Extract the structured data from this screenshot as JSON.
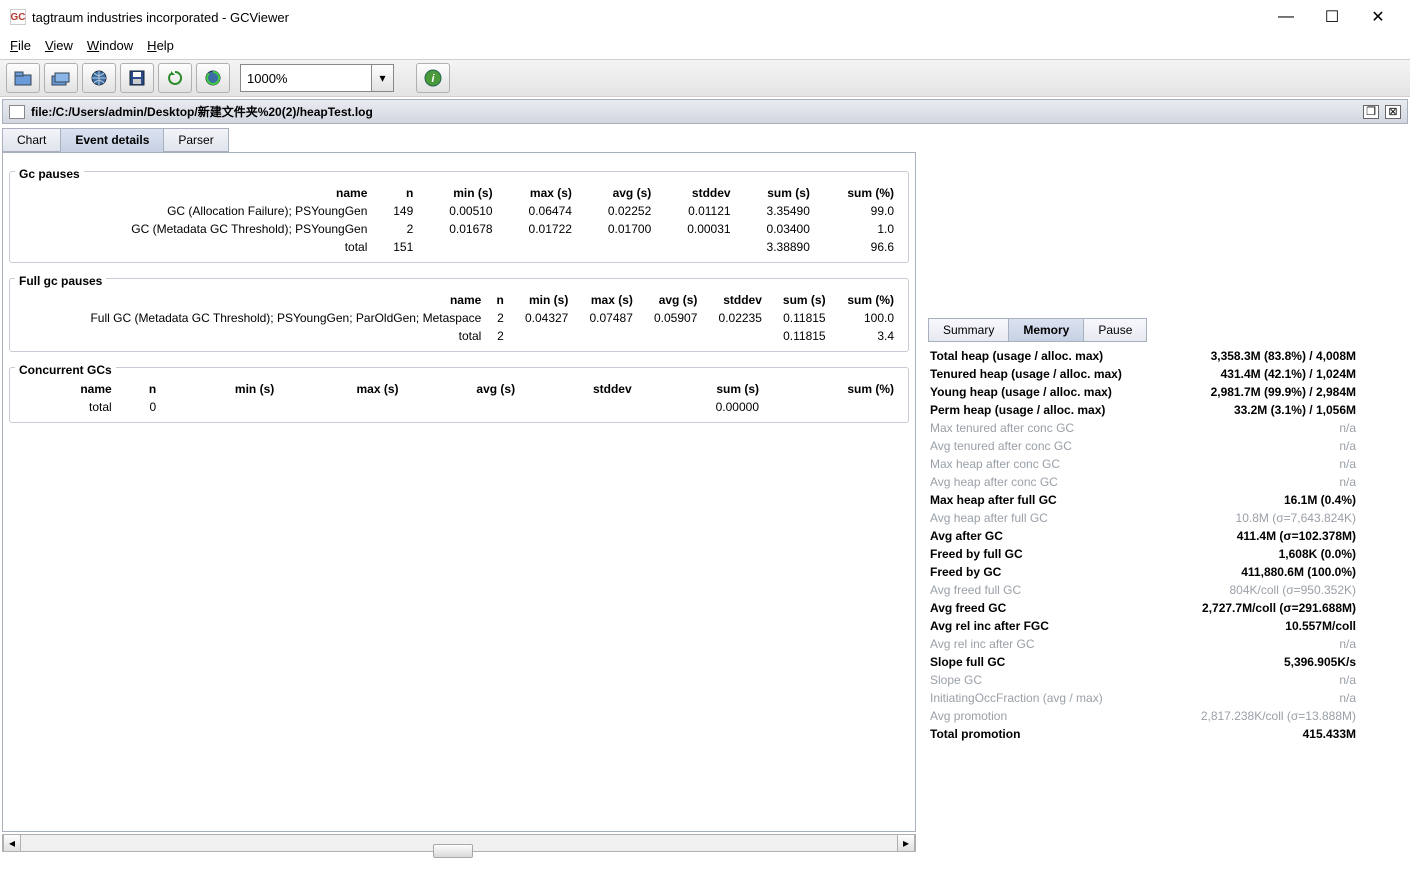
{
  "title": "tagtraum industries incorporated - GCViewer",
  "menu": [
    "File",
    "View",
    "Window",
    "Help"
  ],
  "zoom": "1000%",
  "doc_title": "file:/C:/Users/admin/Desktop/新建文件夹%20(2)/heapTest.log",
  "tabs": [
    "Chart",
    "Event details",
    "Parser"
  ],
  "active_tab": "Event details",
  "sections": {
    "gc_pauses": {
      "title": "Gc pauses",
      "headers": [
        "name",
        "n",
        "min (s)",
        "max (s)",
        "avg (s)",
        "stddev",
        "sum (s)",
        "sum (%)"
      ],
      "rows": [
        [
          "GC (Allocation Failure); PSYoungGen",
          "149",
          "0.00510",
          "0.06474",
          "0.02252",
          "0.01121",
          "3.35490",
          "99.0"
        ],
        [
          "GC (Metadata GC Threshold); PSYoungGen",
          "2",
          "0.01678",
          "0.01722",
          "0.01700",
          "0.00031",
          "0.03400",
          "1.0"
        ],
        [
          "total",
          "151",
          "",
          "",
          "",
          "",
          "3.38890",
          "96.6"
        ]
      ]
    },
    "full_gc_pauses": {
      "title": "Full gc pauses",
      "headers": [
        "name",
        "n",
        "min (s)",
        "max (s)",
        "avg (s)",
        "stddev",
        "sum (s)",
        "sum (%)"
      ],
      "rows": [
        [
          "Full GC (Metadata GC Threshold); PSYoungGen; ParOldGen; Metaspace",
          "2",
          "0.04327",
          "0.07487",
          "0.05907",
          "0.02235",
          "0.11815",
          "100.0"
        ],
        [
          "total",
          "2",
          "",
          "",
          "",
          "",
          "0.11815",
          "3.4"
        ]
      ]
    },
    "concurrent_gcs": {
      "title": "Concurrent GCs",
      "headers": [
        "name",
        "n",
        "min (s)",
        "max (s)",
        "avg (s)",
        "stddev",
        "sum (s)",
        "sum (%)"
      ],
      "rows": [
        [
          "total",
          "0",
          "",
          "",
          "",
          "",
          "0.00000",
          ""
        ]
      ]
    }
  },
  "right_tabs": [
    "Summary",
    "Memory",
    "Pause"
  ],
  "right_active": "Memory",
  "stats": [
    {
      "label": "Total heap (usage / alloc. max)",
      "value": "3,358.3M (83.8%) / 4,008M",
      "dim": false
    },
    {
      "label": "Tenured heap (usage / alloc. max)",
      "value": "431.4M (42.1%) / 1,024M",
      "dim": false
    },
    {
      "label": "Young heap (usage / alloc. max)",
      "value": "2,981.7M (99.9%) / 2,984M",
      "dim": false
    },
    {
      "label": "Perm heap (usage / alloc. max)",
      "value": "33.2M (3.1%) / 1,056M",
      "dim": false
    },
    {
      "label": "Max tenured after conc GC",
      "value": "n/a",
      "dim": true
    },
    {
      "label": "Avg tenured after conc GC",
      "value": "n/a",
      "dim": true
    },
    {
      "label": "Max heap after conc GC",
      "value": "n/a",
      "dim": true
    },
    {
      "label": "Avg heap after conc GC",
      "value": "n/a",
      "dim": true
    },
    {
      "label": "Max heap after full GC",
      "value": "16.1M (0.4%)",
      "dim": false
    },
    {
      "label": "Avg heap after full GC",
      "value": "10.8M (σ=7,643.824K)",
      "dim": true
    },
    {
      "label": "Avg after GC",
      "value": "411.4M (σ=102.378M)",
      "dim": false
    },
    {
      "label": "Freed by full GC",
      "value": "1,608K (0.0%)",
      "dim": false
    },
    {
      "label": "Freed by GC",
      "value": "411,880.6M (100.0%)",
      "dim": false
    },
    {
      "label": "Avg freed full GC",
      "value": "804K/coll (σ=950.352K)",
      "dim": true
    },
    {
      "label": "Avg freed GC",
      "value": "2,727.7M/coll (σ=291.688M)",
      "dim": false
    },
    {
      "label": "Avg rel inc after FGC",
      "value": "10.557M/coll",
      "dim": false
    },
    {
      "label": "Avg rel inc after GC",
      "value": "n/a",
      "dim": true
    },
    {
      "label": "Slope full GC",
      "value": "5,396.905K/s",
      "dim": false
    },
    {
      "label": "Slope GC",
      "value": "n/a",
      "dim": true
    },
    {
      "label": "InitiatingOccFraction (avg / max)",
      "value": "n/a",
      "dim": true
    },
    {
      "label": "Avg promotion",
      "value": "2,817.238K/coll (σ=13.888M)",
      "dim": true
    },
    {
      "label": "Total promotion",
      "value": "415.433M",
      "dim": false
    }
  ]
}
